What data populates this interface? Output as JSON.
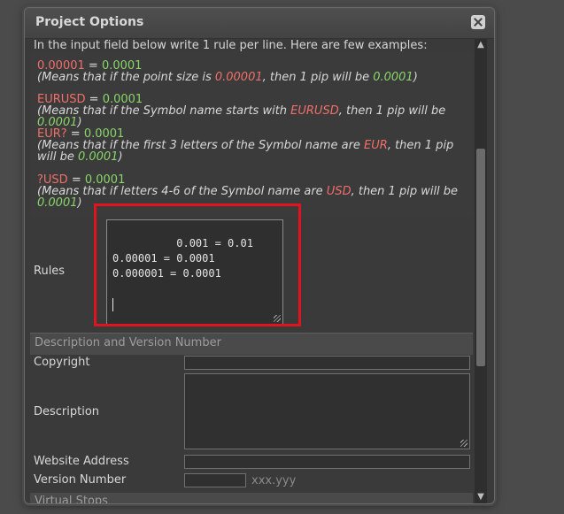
{
  "window": {
    "title": "Project Options",
    "close_icon": "close-icon"
  },
  "intro_text": "In the input field below write 1 rule per line. Here are few examples:",
  "examples": [
    {
      "rule_left": "0.00001",
      "equals": " = ",
      "rule_right": "0.0001",
      "note_prefix": "(Means that if the point size is ",
      "note_red": "0.00001",
      "note_mid": ", then 1 pip will be ",
      "note_green": "0.0001",
      "note_suffix": ")"
    },
    {
      "rule_left": "EURUSD",
      "equals": " = ",
      "rule_right": "0.0001",
      "note_prefix": "(Means that if the Symbol name starts with ",
      "note_red": "EURUSD",
      "note_mid": ", then 1 pip will be ",
      "note_green": "0.0001",
      "note_suffix": ")"
    },
    {
      "rule_left": "EUR?",
      "equals": " = ",
      "rule_right": "0.0001",
      "note_prefix": "(Means that if the first 3 letters of the Symbol name are ",
      "note_red": "EUR",
      "note_mid": ", then 1 pip will be ",
      "note_green": "0.0001",
      "note_suffix": ")"
    },
    {
      "rule_left": "?USD",
      "equals": " = ",
      "rule_right": "0.0001",
      "note_prefix": "(Means that if letters 4-6 of the Symbol name are ",
      "note_red": "USD",
      "note_mid": ", then 1 pip will be ",
      "note_green": "0.0001",
      "note_suffix": ")"
    }
  ],
  "rules": {
    "label": "Rules",
    "value": "0.001 = 0.01\n0.00001 = 0.0001\n0.000001 = 0.0001"
  },
  "section_description": {
    "header": "Description and Version Number",
    "copyright_label": "Copyright",
    "copyright_value": "",
    "description_label": "Description",
    "description_value": "",
    "website_label": "Website Address",
    "website_value": "",
    "version_label": "Version Number",
    "version_value": "",
    "version_placeholder": "xxx.yyy"
  },
  "section_virtual_stops": {
    "header": "Virtual Stops"
  },
  "colors": {
    "rule_red": "#f06f6a",
    "rule_green": "#88d56a",
    "highlight": "#e0141d"
  }
}
